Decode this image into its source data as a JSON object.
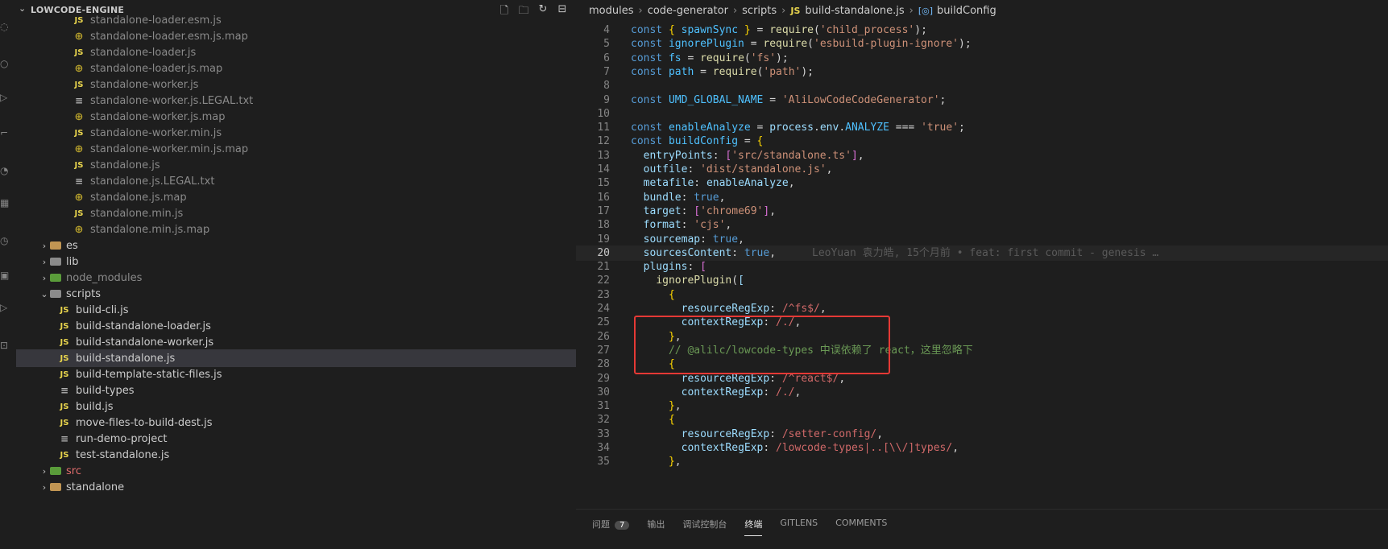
{
  "explorer": {
    "title": "LOWCODE-ENGINE",
    "actions": [
      "new-file-icon",
      "new-folder-icon",
      "refresh-icon",
      "collapse-all-icon"
    ],
    "items": [
      {
        "label": "standalone-loader.esm.js",
        "icon": "js",
        "indent": 70
      },
      {
        "label": "standalone-loader.esm.js.map",
        "icon": "map",
        "indent": 70
      },
      {
        "label": "standalone-loader.js",
        "icon": "js",
        "indent": 70
      },
      {
        "label": "standalone-loader.js.map",
        "icon": "map",
        "indent": 70
      },
      {
        "label": "standalone-worker.js",
        "icon": "js",
        "indent": 70
      },
      {
        "label": "standalone-worker.js.LEGAL.txt",
        "icon": "txt",
        "indent": 70
      },
      {
        "label": "standalone-worker.js.map",
        "icon": "map",
        "indent": 70
      },
      {
        "label": "standalone-worker.min.js",
        "icon": "js",
        "indent": 70
      },
      {
        "label": "standalone-worker.min.js.map",
        "icon": "map",
        "indent": 70
      },
      {
        "label": "standalone.js",
        "icon": "js",
        "indent": 70
      },
      {
        "label": "standalone.js.LEGAL.txt",
        "icon": "txt",
        "indent": 70
      },
      {
        "label": "standalone.js.map",
        "icon": "map",
        "indent": 70
      },
      {
        "label": "standalone.min.js",
        "icon": "js",
        "indent": 70
      },
      {
        "label": "standalone.min.js.map",
        "icon": "map",
        "indent": 70
      },
      {
        "label": "es",
        "icon": "folder",
        "indent": 28,
        "chevron": "›"
      },
      {
        "label": "lib",
        "icon": "folder-gray",
        "indent": 28,
        "chevron": "›"
      },
      {
        "label": "node_modules",
        "icon": "folder-green",
        "indent": 28,
        "chevron": "›"
      },
      {
        "label": "scripts",
        "icon": "folder-gray",
        "indent": 28,
        "chevron": "⌄"
      },
      {
        "label": "build-cli.js",
        "icon": "js",
        "indent": 52
      },
      {
        "label": "build-standalone-loader.js",
        "icon": "js",
        "indent": 52
      },
      {
        "label": "build-standalone-worker.js",
        "icon": "js",
        "indent": 52
      },
      {
        "label": "build-standalone.js",
        "icon": "js",
        "indent": 52,
        "selected": true
      },
      {
        "label": "build-template-static-files.js",
        "icon": "js",
        "indent": 52
      },
      {
        "label": "build-types",
        "icon": "txt",
        "indent": 52
      },
      {
        "label": "build.js",
        "icon": "js",
        "indent": 52
      },
      {
        "label": "move-files-to-build-dest.js",
        "icon": "js",
        "indent": 52
      },
      {
        "label": "run-demo-project",
        "icon": "txt",
        "indent": 52
      },
      {
        "label": "test-standalone.js",
        "icon": "js",
        "indent": 52
      },
      {
        "label": "src",
        "icon": "folder-green",
        "indent": 28,
        "chevron": "›",
        "status": "error"
      },
      {
        "label": "standalone",
        "icon": "folder",
        "indent": 28,
        "chevron": "›"
      }
    ]
  },
  "breadcrumb": [
    "modules",
    "code-generator",
    "scripts",
    "build-standalone.js",
    "buildConfig"
  ],
  "editor": {
    "current_line": 20,
    "blame": "LeoYuan 袁力皓, 15个月前 • feat: first commit - genesis …",
    "lines": [
      {
        "n": "4",
        "html": "<span class='kw'>const</span> <span class='br'>{</span> <span class='cn'>spawnSync</span> <span class='br'>}</span> = <span class='fn'>require</span>(<span class='st'>'child_process'</span>);"
      },
      {
        "n": "5",
        "html": "<span class='kw'>const</span> <span class='cn'>ignorePlugin</span> = <span class='fn'>require</span>(<span class='st'>'esbuild-plugin-ignore'</span>);"
      },
      {
        "n": "6",
        "html": "<span class='kw'>const</span> <span class='cn'>fs</span> = <span class='fn'>require</span>(<span class='st'>'fs'</span>);"
      },
      {
        "n": "7",
        "html": "<span class='kw'>const</span> <span class='cn'>path</span> = <span class='fn'>require</span>(<span class='st'>'path'</span>);"
      },
      {
        "n": "8",
        "html": ""
      },
      {
        "n": "9",
        "html": "<span class='kw'>const</span> <span class='cn'>UMD_GLOBAL_NAME</span> = <span class='st'>'AliLowCodeCodeGenerator'</span>;"
      },
      {
        "n": "10",
        "html": ""
      },
      {
        "n": "11",
        "html": "<span class='kw'>const</span> <span class='cn'>enableAnalyze</span> = <span class='vr'>process</span>.<span class='vr'>env</span>.<span class='cn'>ANALYZE</span> === <span class='st'>'true'</span>;"
      },
      {
        "n": "12",
        "html": "<span class='kw'>const</span> <span class='cn'>buildConfig</span> = <span class='br'>{</span>"
      },
      {
        "n": "13",
        "html": "  <span class='vr'>entryPoints</span>: <span class='pp'>[</span><span class='st'>'src/standalone.ts'</span><span class='pp'>]</span>,"
      },
      {
        "n": "14",
        "html": "  <span class='vr'>outfile</span>: <span class='st'>'dist/standalone.js'</span>,"
      },
      {
        "n": "15",
        "html": "  <span class='vr'>metafile</span>: <span class='vr'>enableAnalyze</span>,"
      },
      {
        "n": "16",
        "html": "  <span class='vr'>bundle</span>: <span class='bl'>true</span>,"
      },
      {
        "n": "17",
        "html": "  <span class='vr'>target</span>: <span class='pp'>[</span><span class='st'>'chrome69'</span><span class='pp'>]</span>,"
      },
      {
        "n": "18",
        "html": "  <span class='vr'>format</span>: <span class='st'>'cjs'</span>,"
      },
      {
        "n": "19",
        "html": "  <span class='vr'>sourcemap</span>: <span class='bl'>true</span>,"
      },
      {
        "n": "20",
        "html": "  <span class='vr'>sourcesContent</span>: <span class='bl'>true</span>,"
      },
      {
        "n": "21",
        "html": "  <span class='vr'>plugins</span>: <span class='pp'>[</span>"
      },
      {
        "n": "22",
        "html": "    <span class='fn'>ignorePlugin</span>(<span class='vr'>[</span>"
      },
      {
        "n": "23",
        "html": "      <span class='br'>{</span>"
      },
      {
        "n": "24",
        "html": "        <span class='vr'>resourceRegExp</span>: <span class='rx'>/^fs$/</span>,"
      },
      {
        "n": "25",
        "html": "        <span class='vr'>contextRegExp</span>: <span class='rx'>/./</span>,"
      },
      {
        "n": "26",
        "html": "      <span class='br'>}</span>,"
      },
      {
        "n": "27",
        "html": "      <span class='cm'>// @alilc/lowcode-types 中误依赖了 react，这里忽略下</span>"
      },
      {
        "n": "28",
        "html": "      <span class='br'>{</span>"
      },
      {
        "n": "29",
        "html": "        <span class='vr'>resourceRegExp</span>: <span class='rx'>/^react$/</span>,"
      },
      {
        "n": "30",
        "html": "        <span class='vr'>contextRegExp</span>: <span class='rx'>/./</span>,"
      },
      {
        "n": "31",
        "html": "      <span class='br'>}</span>,"
      },
      {
        "n": "32",
        "html": "      <span class='br'>{</span>"
      },
      {
        "n": "33",
        "html": "        <span class='vr'>resourceRegExp</span>: <span class='rx'>/setter-config/</span>,"
      },
      {
        "n": "34",
        "html": "        <span class='vr'>contextRegExp</span>: <span class='rx'>/lowcode-types|..[\\\\/]types/</span>,"
      },
      {
        "n": "35",
        "html": "      <span class='br'>}</span>,"
      }
    ]
  },
  "panel": {
    "tabs": [
      {
        "label": "问题",
        "badge": "7"
      },
      {
        "label": "输出"
      },
      {
        "label": "调试控制台"
      },
      {
        "label": "终端",
        "active": true
      },
      {
        "label": "GITLENS"
      },
      {
        "label": "COMMENTS"
      }
    ]
  }
}
